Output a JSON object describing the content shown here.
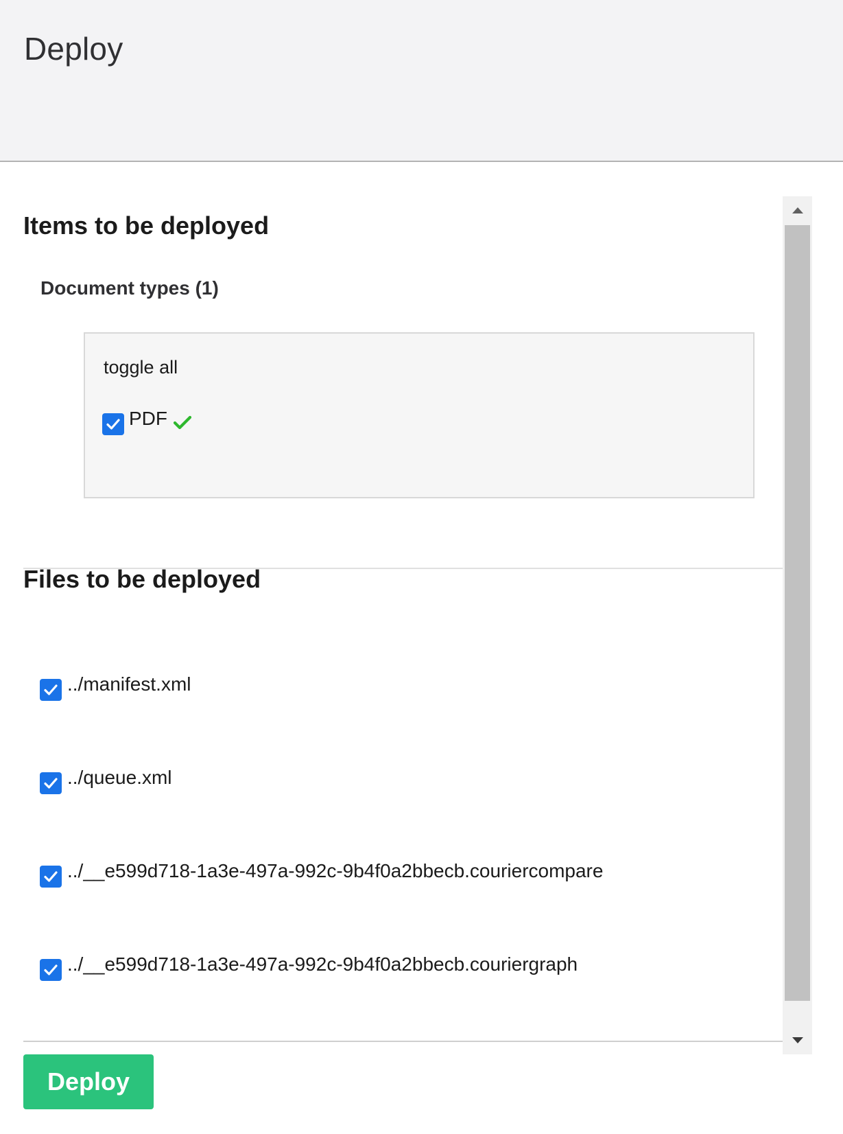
{
  "header": {
    "title": "Deploy"
  },
  "items_section": {
    "title": "Items to be deployed",
    "document_types": {
      "title": "Document types (1)",
      "toggle_all_label": "toggle all",
      "items": [
        {
          "label": "PDF",
          "checked": true,
          "status_icon": "green-check-icon"
        }
      ]
    }
  },
  "files_section": {
    "title": "Files to be deployed",
    "files": [
      {
        "label": "../manifest.xml",
        "checked": true
      },
      {
        "label": "../queue.xml",
        "checked": true
      },
      {
        "label": "../__e599d718-1a3e-497a-992c-9b4f0a2bbecb.couriercompare",
        "checked": true
      },
      {
        "label": "../__e599d718-1a3e-497a-992c-9b4f0a2bbecb.couriergraph",
        "checked": true
      }
    ]
  },
  "footer": {
    "deploy_label": "Deploy"
  },
  "colors": {
    "checkbox": "#1a73e8",
    "deploy_button": "#2bc37c",
    "status_check": "#2eb82e",
    "header_bg": "#f3f3f5"
  }
}
